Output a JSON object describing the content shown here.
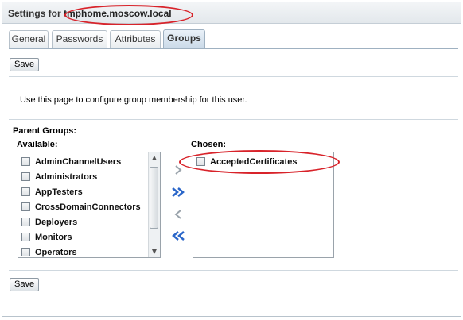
{
  "header": {
    "title_prefix": "Settings for ",
    "host": "tmphome.moscow.local"
  },
  "tabs": [
    {
      "label": "General",
      "active": false
    },
    {
      "label": "Passwords",
      "active": false
    },
    {
      "label": "Attributes",
      "active": false
    },
    {
      "label": "Groups",
      "active": true
    }
  ],
  "buttons": {
    "save_top": "Save",
    "save_bottom": "Save"
  },
  "description": "Use this page to configure group membership for this user.",
  "parent_groups_label": "Parent Groups:",
  "available": {
    "label": "Available:",
    "items": [
      "AdminChannelUsers",
      "Administrators",
      "AppTesters",
      "CrossDomainConnectors",
      "Deployers",
      "Monitors",
      "Operators"
    ]
  },
  "chosen": {
    "label": "Chosen:",
    "items": [
      "AcceptedCertificates"
    ]
  },
  "shuttle_icons": [
    "move-right-icon",
    "move-all-right-icon",
    "move-left-icon",
    "move-all-left-icon"
  ],
  "colors": {
    "annotation": "#d8232a",
    "shuttle_active": "#2a66c9",
    "shuttle_disabled": "#9aa3ab"
  }
}
